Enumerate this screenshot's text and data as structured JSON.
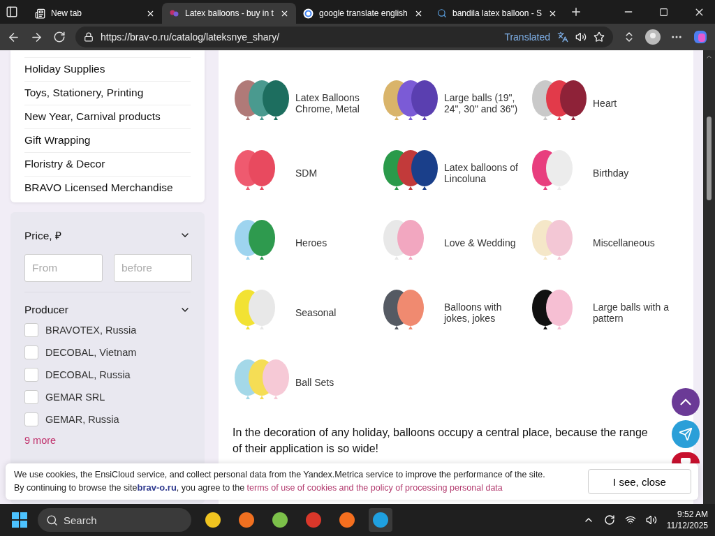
{
  "browser": {
    "tabs": [
      {
        "title": "New tab",
        "selected": false
      },
      {
        "title": "Latex balloons - buy in t",
        "selected": true
      },
      {
        "title": "google translate english",
        "selected": false
      },
      {
        "title": "bandila latex balloon - S",
        "selected": false
      }
    ],
    "address": "https://brav-o.ru/catalog/lateksnye_shary/",
    "translated": "Translated"
  },
  "sidebar": {
    "categories": [
      "Holiday Supplies",
      "Toys, Stationery, Printing",
      "New Year, Carnival products",
      "Gift Wrapping",
      "Floristry & Decor",
      "BRAVO Licensed Merchandise"
    ],
    "filters": {
      "price": {
        "title": "Price, ₽",
        "from_placeholder": "From",
        "to_placeholder": "before"
      },
      "producer": {
        "title": "Producer",
        "options": [
          {
            "label": "BRAVOTEX, Russia",
            "checked": false
          },
          {
            "label": "DECOBAL, Vietnam",
            "checked": false
          },
          {
            "label": "DECOBAL, Russia",
            "checked": false
          },
          {
            "label": "GEMAR SRL",
            "checked": false
          },
          {
            "label": "GEMAR, Russia",
            "checked": false
          }
        ],
        "more": "9 more"
      }
    }
  },
  "catalog": {
    "items": [
      {
        "label": "Latex Balloons Chrome, Metal"
      },
      {
        "label": "Large balls (19\", 24\", 30\" and 36\")"
      },
      {
        "label": "Heart"
      },
      {
        "label": "SDM"
      },
      {
        "label": "Latex balloons of Lincoluna"
      },
      {
        "label": "Birthday"
      },
      {
        "label": "Heroes"
      },
      {
        "label": "Love & Wedding"
      },
      {
        "label": "Miscellaneous"
      },
      {
        "label": "Seasonal"
      },
      {
        "label": "Balloons with jokes, jokes"
      },
      {
        "label": "Large balls with a pattern"
      },
      {
        "label": "Ball Sets"
      }
    ],
    "description": "In the decoration of any holiday, balloons occupy a central place, because the range of their application is so wide!"
  },
  "cookie_banner": {
    "line1": "We use cookies, the EnsiCloud service, and collect personal data from the Yandex.Metrica service to improve the performance of the site.",
    "line2_start": "By continuing to browse the site",
    "logo": "brav-o.ru",
    "line2_mid": ", you agree to the ",
    "link": "terms of use of cookies and the policy of processing personal data",
    "button": "I see, close"
  },
  "taskbar": {
    "search": "Search",
    "time": "9:52 AM",
    "date": "11/12/2025"
  }
}
